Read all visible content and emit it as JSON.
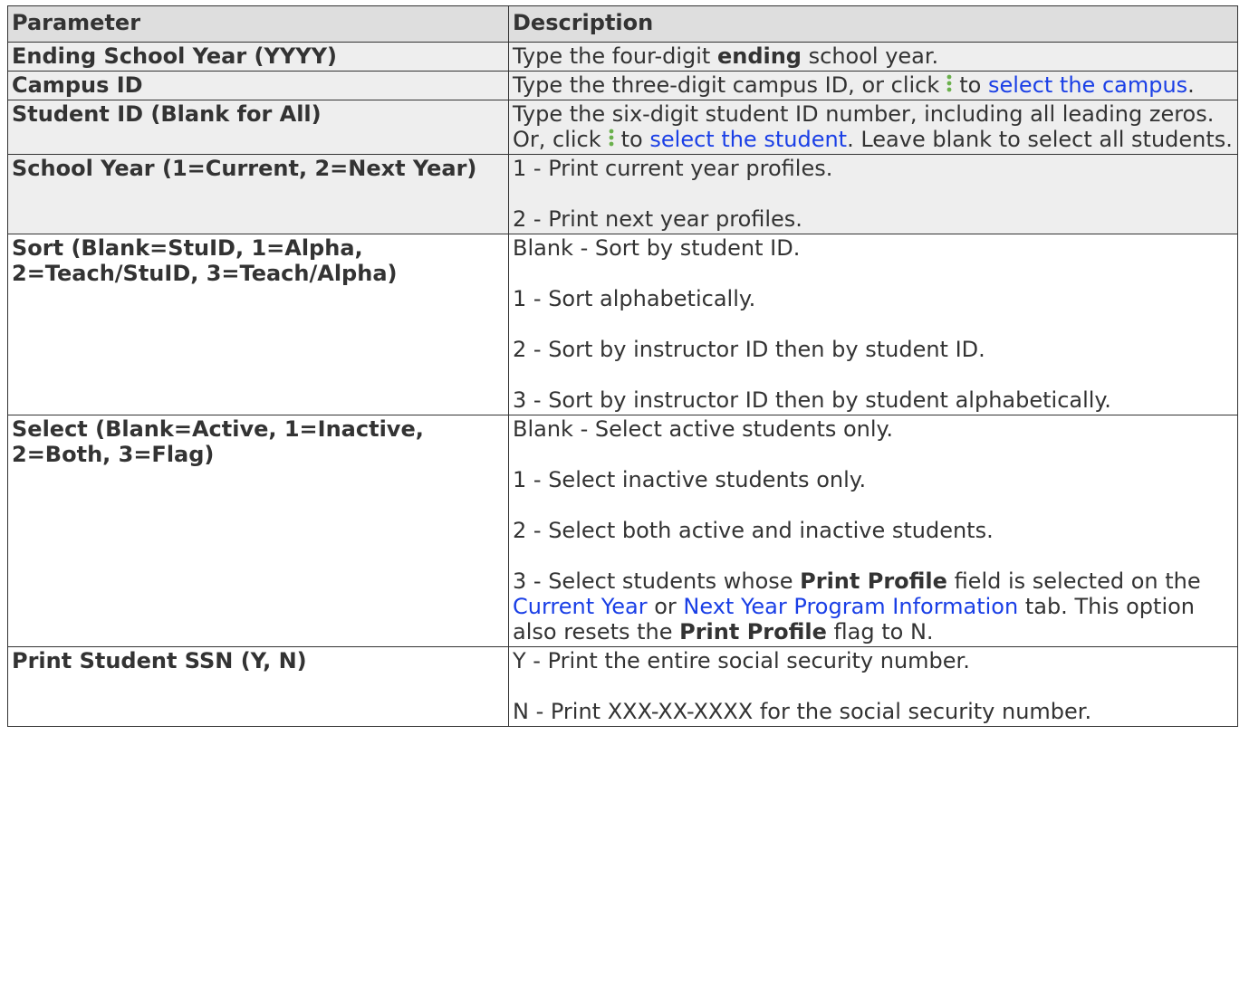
{
  "table": {
    "headers": {
      "parameter": "Parameter",
      "description": "Description"
    },
    "rows": {
      "ending_year": {
        "param": "Ending School Year (YYYY)",
        "d1": "Type the four-digit ",
        "d1_bold": "ending",
        "d1_end": " school year."
      },
      "campus_id": {
        "param": "Campus ID",
        "d1": "Type the three-digit campus ID, or click",
        "d1_mid": "to ",
        "link": "select the campus",
        "d1_end": "."
      },
      "student_id": {
        "param": "Student ID (Blank for All)",
        "d1": "Type the six-digit student ID number, including all leading zeros. Or, click",
        "d1_mid": "to ",
        "link": "select the student",
        "d1_end": ". Leave blank to select all students."
      },
      "school_year": {
        "param": "School Year (1=Current, 2=Next Year)",
        "lines": [
          "1 - Print current year profiles.",
          "2 - Print next year profiles."
        ]
      },
      "sort": {
        "param": "Sort (Blank=StuID, 1=Alpha, 2=Teach/StuID, 3=Teach/Alpha)",
        "lines": [
          "Blank - Sort by student ID.",
          "1 - Sort alphabetically.",
          "2 - Sort by instructor ID then by student ID.",
          "3 - Sort by instructor ID then by student alphabetically."
        ]
      },
      "select": {
        "param": "Select (Blank=Active, 1=Inactive, 2=Both, 3=Flag)",
        "lines": [
          "Blank - Select active students only.",
          "1 - Select inactive students only.",
          "2 - Select both active and inactive students."
        ],
        "l4_a": "3 - Select students whose ",
        "l4_bold1": "Print Profile",
        "l4_b": " field is selected on the ",
        "l4_link1": "Current Year",
        "l4_c": " or ",
        "l4_link2": "Next Year Program Information",
        "l4_d": " tab. This option also resets the ",
        "l4_bold2": "Print Profile",
        "l4_e": " flag to N."
      },
      "ssn": {
        "param": "Print Student SSN (Y, N)",
        "lines": [
          "Y - Print the entire social security number.",
          "N - Print XXX-XX-XXXX for the social security number."
        ]
      }
    }
  },
  "colors": {
    "header_bg": "#dedede",
    "shaded_row_bg": "#eeeeee",
    "link": "#1a3fe6",
    "icon": "#6ab04c"
  },
  "icons": {
    "lookup": "kebab-lookup-icon"
  }
}
